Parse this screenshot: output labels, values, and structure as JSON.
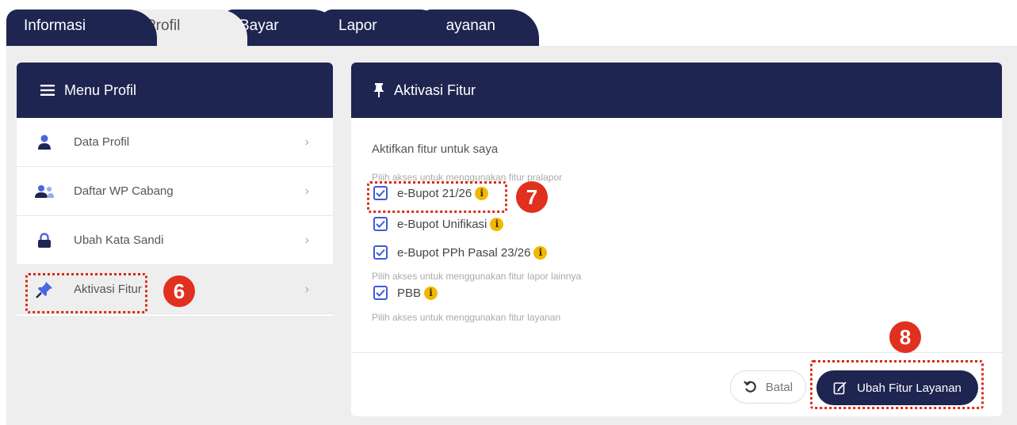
{
  "tabs": [
    {
      "label": "Informasi"
    },
    {
      "label": "Profil"
    },
    {
      "label": "Bayar"
    },
    {
      "label": "Lapor"
    },
    {
      "label": "Layanan"
    }
  ],
  "menu": {
    "title": "Menu Profil",
    "items": [
      {
        "label": "Data Profil",
        "icon": "user-icon"
      },
      {
        "label": "Daftar WP Cabang",
        "icon": "users-icon"
      },
      {
        "label": "Ubah Kata Sandi",
        "icon": "lock-icon"
      },
      {
        "label": "Aktivasi Fitur",
        "icon": "pin-icon"
      }
    ]
  },
  "panel": {
    "title": "Aktivasi Fitur",
    "subtitle": "Aktifkan fitur untuk saya",
    "group_pralapor": "Pilih akses untuk menggunakan fitur pralapor",
    "group_lapor": "Pilih akses untuk menggunakan fitur lapor lainnya",
    "group_layanan": "Pilih akses untuk menggunakan fitur layanan",
    "features": [
      {
        "label": "e-Bupot 21/26",
        "checked": true
      },
      {
        "label": "e-Bupot Unifikasi",
        "checked": true
      },
      {
        "label": "e-Bupot PPh Pasal 23/26",
        "checked": true
      },
      {
        "label": "PBB",
        "checked": true
      }
    ],
    "cancel_label": "Batal",
    "submit_label": "Ubah Fitur Layanan"
  },
  "annotations": {
    "step6": "6",
    "step7": "7",
    "step8": "8"
  },
  "colors": {
    "navy": "#1e2550",
    "accent": "#3e5bd8",
    "info": "#f2b700",
    "annotation": "#e0301e"
  }
}
